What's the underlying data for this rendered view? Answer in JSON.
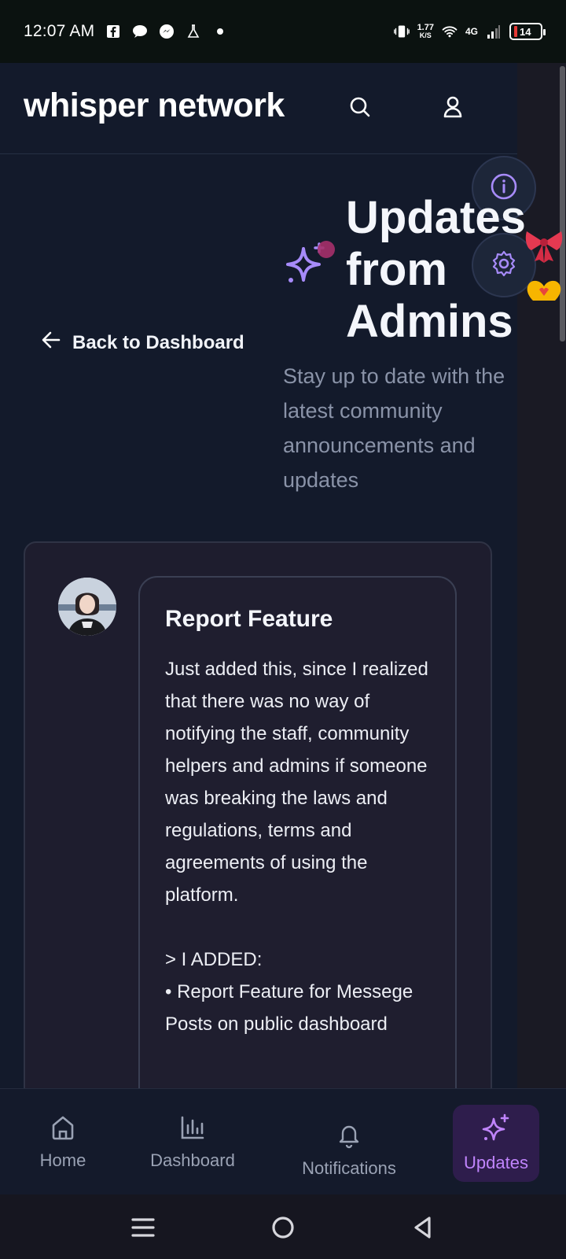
{
  "status_bar": {
    "time": "12:07 AM",
    "speed_value": "1.77",
    "speed_unit": "K/S",
    "network": "4G",
    "battery": "14"
  },
  "header": {
    "brand": "whisper network",
    "search_icon": "search-icon",
    "user_icon": "user-icon"
  },
  "floating": {
    "info_icon": "info-icon",
    "settings_icon": "gear-icon",
    "emoji_bow": "🎀",
    "emoji_heart": "🫶"
  },
  "hero": {
    "icon": "sparkles-icon",
    "title": "Updates from Admins",
    "subtitle": "Stay up to date with the latest community announcements and updates",
    "back_label": "Back to Dashboard"
  },
  "post": {
    "title": "Report Feature",
    "body": "Just added this, since I realized that there was no way of notifying the staff, community helpers and admins if someone was breaking the laws and regulations, terms and agreements of using the platform.\n\n  >  I ADDED:\n   • Report Feature for Messege Posts on public dashboard"
  },
  "bottom_nav": {
    "items": [
      {
        "label": "Home",
        "icon": "home-icon"
      },
      {
        "label": "Dashboard",
        "icon": "bar-chart-icon"
      },
      {
        "label": "Notifications",
        "icon": "bell-icon"
      },
      {
        "label": "Updates",
        "icon": "sparkles-icon",
        "active": true
      }
    ]
  },
  "colors": {
    "background": "#131a2b",
    "accent": "#c084fc",
    "active_tab_bg": "#2e1d4c"
  }
}
